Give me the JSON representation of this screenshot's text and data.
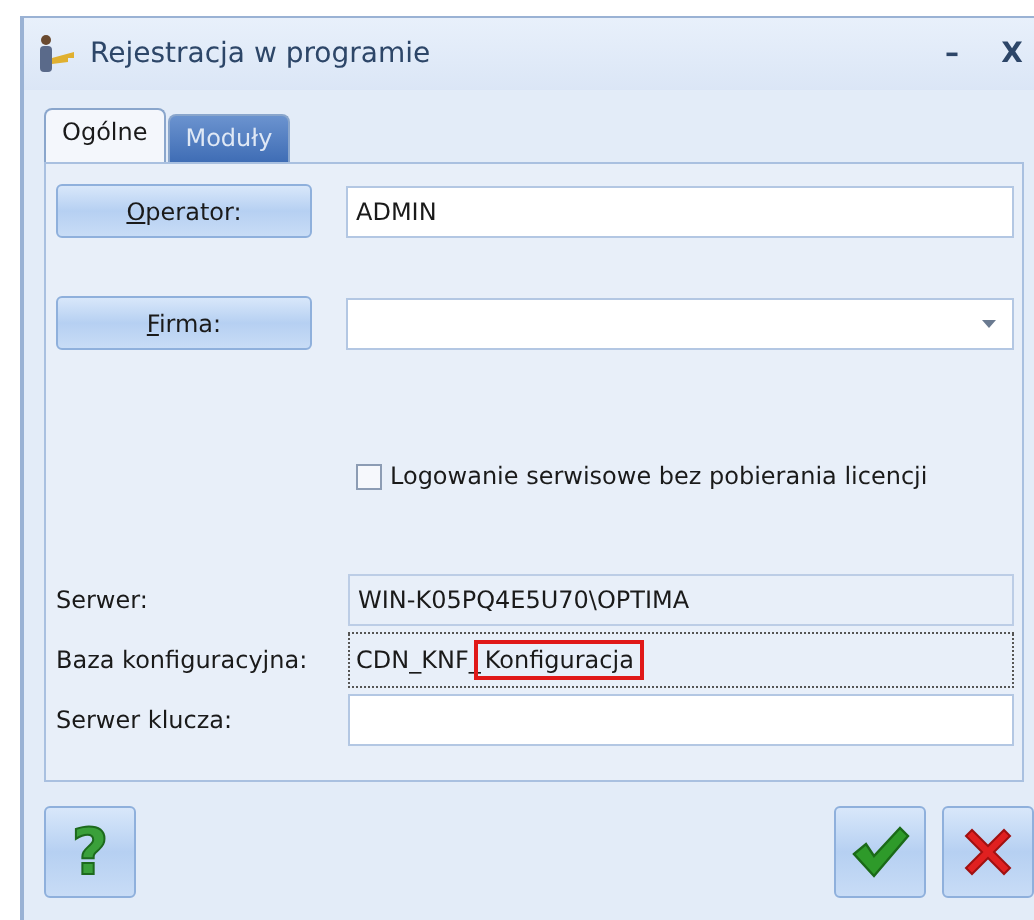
{
  "window": {
    "title": "Rejestracja w programie",
    "controls": [
      "–",
      "X"
    ]
  },
  "tabs": [
    {
      "label": "Ogólne",
      "selected": true
    },
    {
      "label": "Moduły",
      "selected": false
    }
  ],
  "operator": {
    "button": "Operator:",
    "value": "ADMIN"
  },
  "company": {
    "button": "Firma:"
  },
  "service_login": {
    "label": "Logowanie serwisowe bez pobierania licencji",
    "checked": false
  },
  "info_rows": [
    {
      "label": "Serwer:",
      "kind": "readonly",
      "parts": [
        {
          "text": "WIN-K05PQ4E5U70\\OPTIMA",
          "highlighted": false
        }
      ]
    },
    {
      "label": "Baza konfiguracyjna:",
      "kind": "focused",
      "parts": [
        {
          "text": "CDN_KNF_",
          "highlighted": false
        },
        {
          "text": "Konfiguracja",
          "highlighted": true
        }
      ]
    },
    {
      "label": "Serwer klucza:",
      "kind": "editable",
      "parts": []
    }
  ],
  "help_button": {
    "glyph": "?"
  }
}
